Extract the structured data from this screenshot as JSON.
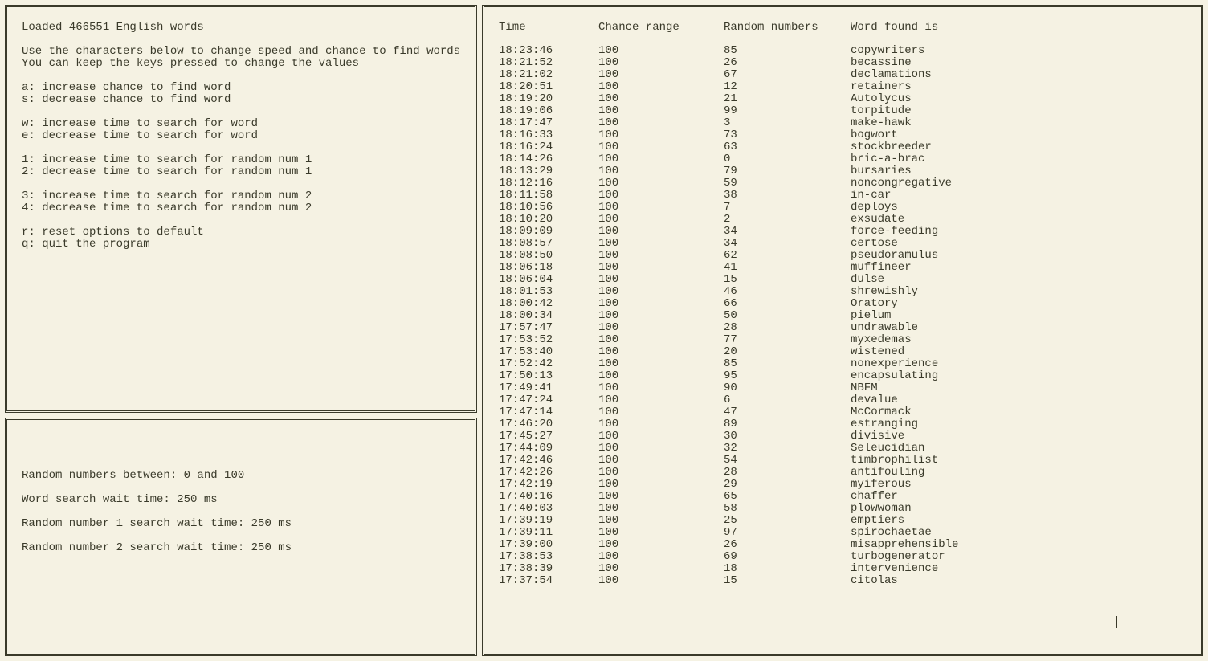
{
  "help": {
    "loaded": "Loaded 466551 English words",
    "intro": [
      "Use the characters below to change speed and chance to find words",
      "You can keep the keys pressed to change the values"
    ],
    "keys": [
      "a: increase chance to find word",
      "s: decrease chance to find word",
      "",
      "w: increase time to search for word",
      "e: decrease time to search for word",
      "",
      "1: increase time to search for random num 1",
      "2: decrease time to search for random num 1",
      "",
      "3: increase time to search for random num 2",
      "4: decrease time to search for random num 2",
      "",
      "r: reset options to default",
      "q: quit the program"
    ]
  },
  "status": {
    "random_range": "Random numbers between: 0 and 100",
    "word_wait": "Word search wait time: 250 ms",
    "rand1_wait": "Random number 1 search wait time: 250 ms",
    "rand2_wait": "Random number 2 search wait time: 250 ms"
  },
  "log": {
    "headers": {
      "time": "Time",
      "chance": "Chance range",
      "random": "Random numbers",
      "word": "Word found is"
    },
    "rows": [
      {
        "time": "18:23:46",
        "chance": "100",
        "random": "85",
        "word": "copywriters"
      },
      {
        "time": "18:21:52",
        "chance": "100",
        "random": "26",
        "word": "becassine"
      },
      {
        "time": "18:21:02",
        "chance": "100",
        "random": "67",
        "word": "declamations"
      },
      {
        "time": "18:20:51",
        "chance": "100",
        "random": "12",
        "word": "retainers"
      },
      {
        "time": "18:19:20",
        "chance": "100",
        "random": "21",
        "word": "Autolycus"
      },
      {
        "time": "18:19:06",
        "chance": "100",
        "random": "99",
        "word": "torpitude"
      },
      {
        "time": "18:17:47",
        "chance": "100",
        "random": "3",
        "word": "make-hawk"
      },
      {
        "time": "18:16:33",
        "chance": "100",
        "random": "73",
        "word": "bogwort"
      },
      {
        "time": "18:16:24",
        "chance": "100",
        "random": "63",
        "word": "stockbreeder"
      },
      {
        "time": "18:14:26",
        "chance": "100",
        "random": "0",
        "word": "bric-a-brac"
      },
      {
        "time": "18:13:29",
        "chance": "100",
        "random": "79",
        "word": "bursaries"
      },
      {
        "time": "18:12:16",
        "chance": "100",
        "random": "59",
        "word": "noncongregative"
      },
      {
        "time": "18:11:58",
        "chance": "100",
        "random": "38",
        "word": "in-car"
      },
      {
        "time": "18:10:56",
        "chance": "100",
        "random": "7",
        "word": "deploys"
      },
      {
        "time": "18:10:20",
        "chance": "100",
        "random": "2",
        "word": "exsudate"
      },
      {
        "time": "18:09:09",
        "chance": "100",
        "random": "34",
        "word": "force-feeding"
      },
      {
        "time": "18:08:57",
        "chance": "100",
        "random": "34",
        "word": "certose"
      },
      {
        "time": "18:08:50",
        "chance": "100",
        "random": "62",
        "word": "pseudoramulus"
      },
      {
        "time": "18:06:18",
        "chance": "100",
        "random": "41",
        "word": "muffineer"
      },
      {
        "time": "18:06:04",
        "chance": "100",
        "random": "15",
        "word": "dulse"
      },
      {
        "time": "18:01:53",
        "chance": "100",
        "random": "46",
        "word": "shrewishly"
      },
      {
        "time": "18:00:42",
        "chance": "100",
        "random": "66",
        "word": "Oratory"
      },
      {
        "time": "18:00:34",
        "chance": "100",
        "random": "50",
        "word": "pielum"
      },
      {
        "time": "17:57:47",
        "chance": "100",
        "random": "28",
        "word": "undrawable"
      },
      {
        "time": "17:53:52",
        "chance": "100",
        "random": "77",
        "word": "myxedemas"
      },
      {
        "time": "17:53:40",
        "chance": "100",
        "random": "20",
        "word": "wistened"
      },
      {
        "time": "17:52:42",
        "chance": "100",
        "random": "85",
        "word": "nonexperience"
      },
      {
        "time": "17:50:13",
        "chance": "100",
        "random": "95",
        "word": "encapsulating"
      },
      {
        "time": "17:49:41",
        "chance": "100",
        "random": "90",
        "word": "NBFM"
      },
      {
        "time": "17:47:24",
        "chance": "100",
        "random": "6",
        "word": "devalue"
      },
      {
        "time": "17:47:14",
        "chance": "100",
        "random": "47",
        "word": "McCormack"
      },
      {
        "time": "17:46:20",
        "chance": "100",
        "random": "89",
        "word": "estranging"
      },
      {
        "time": "17:45:27",
        "chance": "100",
        "random": "30",
        "word": "divisive"
      },
      {
        "time": "17:44:09",
        "chance": "100",
        "random": "32",
        "word": "Seleucidian"
      },
      {
        "time": "17:42:46",
        "chance": "100",
        "random": "54",
        "word": "timbrophilist"
      },
      {
        "time": "17:42:26",
        "chance": "100",
        "random": "28",
        "word": "antifouling"
      },
      {
        "time": "17:42:19",
        "chance": "100",
        "random": "29",
        "word": "myiferous"
      },
      {
        "time": "17:40:16",
        "chance": "100",
        "random": "65",
        "word": "chaffer"
      },
      {
        "time": "17:40:03",
        "chance": "100",
        "random": "58",
        "word": "plowwoman"
      },
      {
        "time": "17:39:19",
        "chance": "100",
        "random": "25",
        "word": "emptiers"
      },
      {
        "time": "17:39:11",
        "chance": "100",
        "random": "97",
        "word": "spirochaetae"
      },
      {
        "time": "17:39:00",
        "chance": "100",
        "random": "26",
        "word": "misapprehensible"
      },
      {
        "time": "17:38:53",
        "chance": "100",
        "random": "69",
        "word": "turbogenerator"
      },
      {
        "time": "17:38:39",
        "chance": "100",
        "random": "18",
        "word": "intervenience"
      },
      {
        "time": "17:37:54",
        "chance": "100",
        "random": "15",
        "word": "citolas"
      }
    ]
  }
}
